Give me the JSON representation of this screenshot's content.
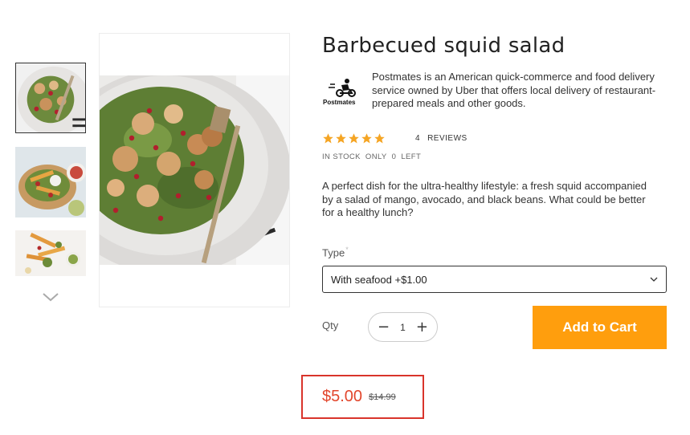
{
  "product": {
    "title": "Barbecued squid salad",
    "vendor": {
      "name": "Postmates",
      "description": "Postmates is an American quick-commerce and food delivery service owned by Uber that offers local delivery of restaurant-prepared meals and other goods."
    },
    "rating": {
      "stars": 5,
      "review_count": "4",
      "reviews_label": "REVIEWS"
    },
    "stock": {
      "status": "IN STOCK",
      "only_label": "ONLY",
      "count": "0",
      "left_label": "LEFT"
    },
    "description": "A perfect dish for the ultra-healthy lifestyle: a fresh squid accompanied by a salad of mango, avocado, and black beans. What could be better for a healthy lunch?",
    "variant": {
      "label": "Type",
      "required_mark": "*",
      "selected": "With seafood +$1.00"
    },
    "quantity": {
      "label": "Qty",
      "value": "1",
      "minus": "−",
      "plus": "+"
    },
    "add_to_cart_label": "Add to Cart",
    "price": "$5.00",
    "compare_price": "$14.99"
  },
  "gallery": {
    "thumbnails": [
      "salad-plate-thumb",
      "salad-board-thumb",
      "salad-fries-thumb"
    ],
    "active_index": 0
  },
  "colors": {
    "accent": "#ff9e0d",
    "price": "#e2462c",
    "star": "#f5a524",
    "highlight_border": "#d9342b"
  },
  "icons": {
    "star": "star-icon",
    "chevron_down": "chevron-down-icon",
    "scroll_down": "chevron-down-icon"
  }
}
